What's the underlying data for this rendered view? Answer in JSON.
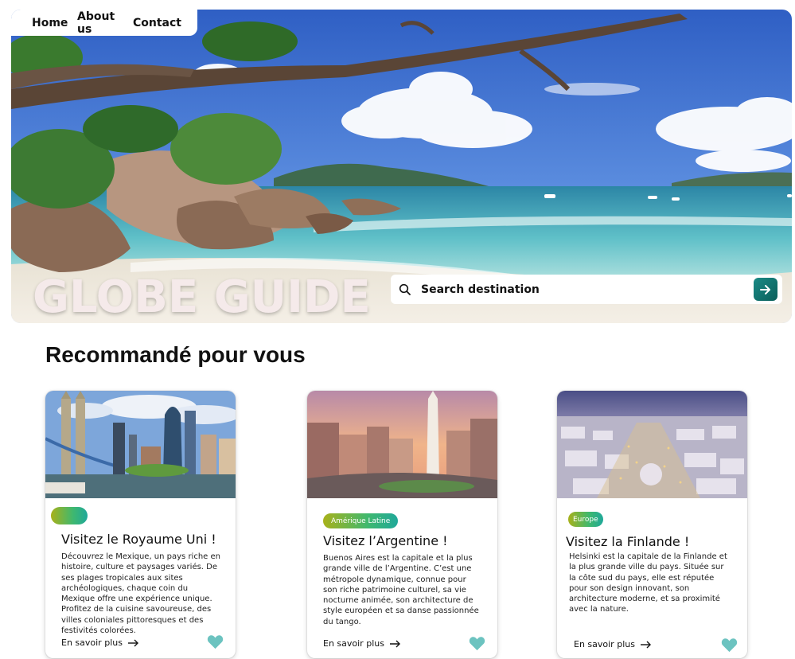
{
  "nav": {
    "home": "Home",
    "about": "About us",
    "contact": "Contact"
  },
  "hero": {
    "brand": "GLOBE GUIDE"
  },
  "search": {
    "placeholder": "Search destination",
    "icon": "search-icon",
    "submit_icon": "arrow-right-icon"
  },
  "section": {
    "title": "Recommandé pour vous"
  },
  "cards": [
    {
      "badge": "",
      "title": "Visitez le Royaume Uni !",
      "description": "Découvrez le Mexique, un pays riche en histoire, culture et paysages variés. De ses plages tropicales aux sites archéologiques, chaque coin du Mexique offre une expérience unique. Profitez de la cuisine  savoureuse, des villes coloniales pittoresques et des festivités colorées.",
      "more": "En savoir plus",
      "icon": "heart-icon"
    },
    {
      "badge": "Amérique Latine",
      "title": "Visitez l’Argentine !",
      "description": "Buenos Aires est la capitale et la plus grande ville de l’Argentine. C’est une métropole dynamique, connue pour son riche patrimoine culturel, sa vie nocturne animée, son architecture de style européen et sa danse passionnée du tango.",
      "more": "En savoir plus",
      "icon": "heart-icon"
    },
    {
      "badge": "Europe",
      "title": "Visitez la Finlande !",
      "description": "Helsinki est la capitale de la Finlande et la plus grande ville du pays. Située sur la côte sud du pays, elle est réputée pour son design innovant, son architecture moderne, et sa proximité avec la nature.",
      "more": "En savoir plus",
      "icon": "heart-icon"
    }
  ],
  "colors": {
    "accent_teal": "#0f6e69",
    "heart": "#6cc3c0",
    "badge_gradient_start": "#a8b11a",
    "badge_gradient_end": "#1fa89a"
  }
}
